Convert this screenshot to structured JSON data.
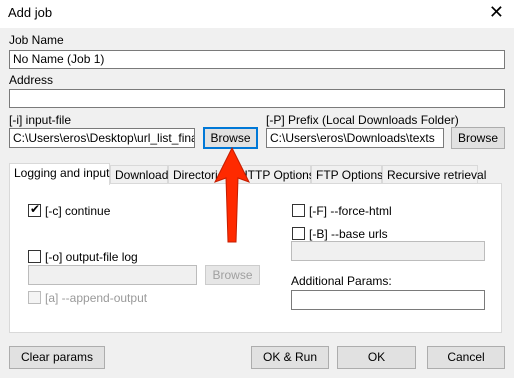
{
  "window": {
    "title": "Add job",
    "close_glyph": "✕"
  },
  "job_name": {
    "label": "Job Name",
    "value": "No Name (Job 1)"
  },
  "address": {
    "label": "Address",
    "value": ""
  },
  "input_file": {
    "label": "[-i] input-file",
    "value": "C:\\Users\\eros\\Desktop\\url_list_final.txt",
    "browse_label": "Browse"
  },
  "prefix": {
    "label": "[-P] Prefix (Local Downloads Folder)",
    "value": "C:\\Users\\eros\\Downloads\\texts",
    "browse_label": "Browse"
  },
  "tabs": [
    {
      "label": "Logging and input",
      "active": true
    },
    {
      "label": "Download",
      "active": false
    },
    {
      "label": "Directories",
      "active": false
    },
    {
      "label": "HTTP Options",
      "active": false
    },
    {
      "label": "FTP Options",
      "active": false
    },
    {
      "label": "Recursive retrieval",
      "active": false
    }
  ],
  "logging": {
    "continue_label": "[-c] continue",
    "continue_checked": true,
    "output_log_label": "[-o] output-file log",
    "output_log_checked": false,
    "output_log_value": "",
    "output_log_browse": "Browse",
    "append_label": "[a] --append-output",
    "append_checked": false
  },
  "right_options": {
    "force_html_label": "[-F] --force-html",
    "force_html_checked": false,
    "base_urls_label": "[-B] --base urls",
    "base_urls_checked": false,
    "base_urls_value": "",
    "additional_params_label": "Additional Params:",
    "additional_params_value": ""
  },
  "footer": {
    "clear_label": "Clear params",
    "ok_run_label": "OK & Run",
    "ok_label": "OK",
    "cancel_label": "Cancel"
  },
  "annotation": {
    "arrow_color": "#ff2a00",
    "icon": "arrow-up-icon"
  },
  "colors": {
    "focus_border": "#0078d7",
    "window_bg": "#f0f0f0"
  }
}
